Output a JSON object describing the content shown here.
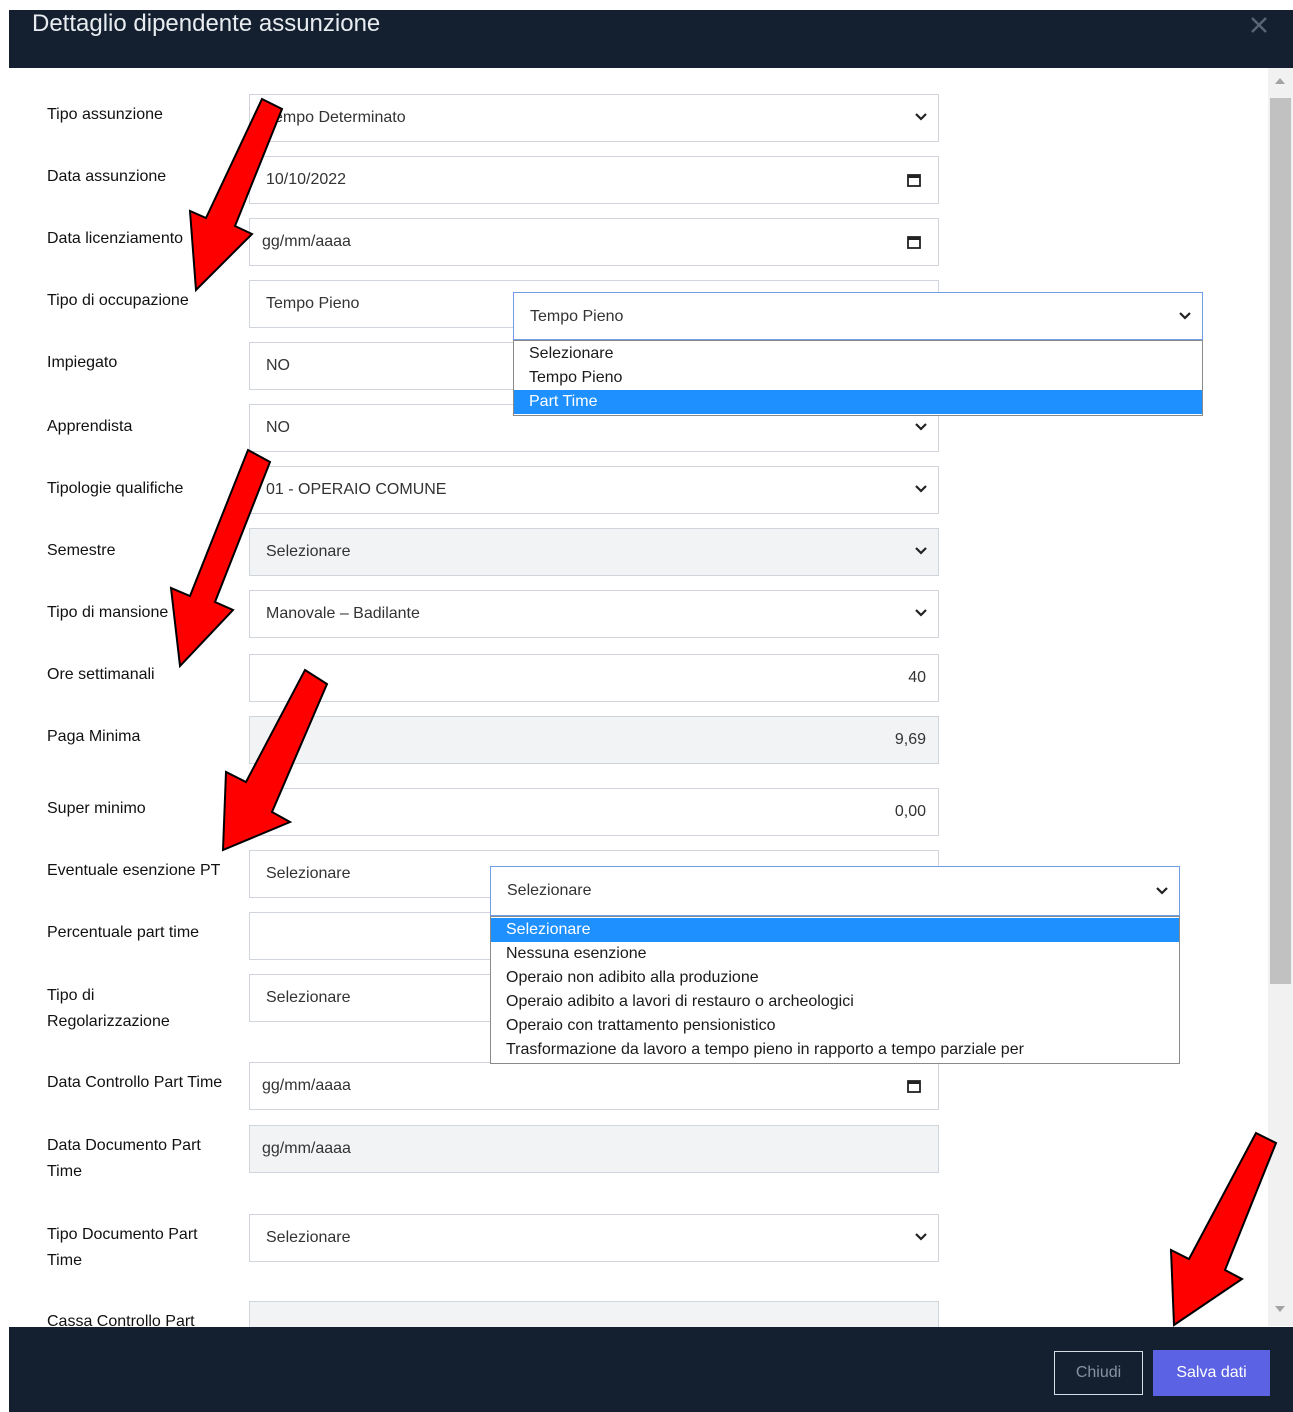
{
  "modal": {
    "title": "Dettaglio dipendente assunzione"
  },
  "form": {
    "tipo_assunzione": {
      "label": "Tipo assunzione",
      "value": "Tempo Determinato"
    },
    "data_assunzione": {
      "label": "Data assunzione",
      "value": "10/10/2022"
    },
    "data_licenziamento": {
      "label": "Data licenziamento",
      "value": "gg/mm/aaaa"
    },
    "tipo_occupazione": {
      "label": "Tipo di occupazione",
      "value": "Tempo Pieno"
    },
    "impiegato": {
      "label": "Impiegato",
      "value": "NO"
    },
    "apprendista": {
      "label": "Apprendista",
      "value": "NO"
    },
    "tipologie_qualifiche": {
      "label": "Tipologie qualifiche",
      "value": "01 - OPERAIO COMUNE"
    },
    "semestre": {
      "label": "Semestre",
      "value": "Selezionare"
    },
    "tipo_mansione": {
      "label": "Tipo di mansione",
      "value": "Manovale – Badilante"
    },
    "ore_settimanali": {
      "label": "Ore settimanali",
      "value": "40"
    },
    "paga_minima": {
      "label": "Paga Minima",
      "value": "9,69"
    },
    "super_minimo": {
      "label": "Super minimo",
      "value": "0,00"
    },
    "esenzione_pt": {
      "label": "Eventuale esenzione PT",
      "value": "Selezionare"
    },
    "percentuale_pt": {
      "label": "Percentuale part time",
      "value": ""
    },
    "tipo_regolarizzazione": {
      "label_1": "Tipo di",
      "label_2": "Regolarizzazione",
      "value": "Selezionare"
    },
    "data_controllo_pt": {
      "label": "Data Controllo Part Time",
      "value": "gg/mm/aaaa"
    },
    "data_documento_pt": {
      "label_1": "Data Documento Part",
      "label_2": "Time",
      "value": "gg/mm/aaaa"
    },
    "tipo_documento_pt": {
      "label_1": "Tipo Documento Part",
      "label_2": "Time",
      "value": "Selezionare"
    },
    "cassa_controllo_pt": {
      "label": "Cassa Controllo Part"
    }
  },
  "dropdown_occupazione": {
    "selected": "Tempo Pieno",
    "options": [
      "Selezionare",
      "Tempo Pieno",
      "Part Time"
    ],
    "highlighted": "Part Time"
  },
  "dropdown_esenzione": {
    "selected": "Selezionare",
    "options": [
      "Selezionare",
      "Nessuna esenzione",
      "Operaio non adibito alla produzione",
      "Operaio adibito a lavori di restauro o archeologici",
      "Operaio con trattamento pensionistico",
      "Trasformazione da lavoro a tempo pieno in rapporto a tempo parziale per"
    ],
    "highlighted": "Selezionare"
  },
  "footer": {
    "close_label": "Chiudi",
    "save_label": "Salva dati"
  },
  "colors": {
    "header_bg": "#14202f",
    "save_button": "#5b62e3",
    "option_highlight": "#1e90ff",
    "annotation_arrow": "#ff0000"
  }
}
